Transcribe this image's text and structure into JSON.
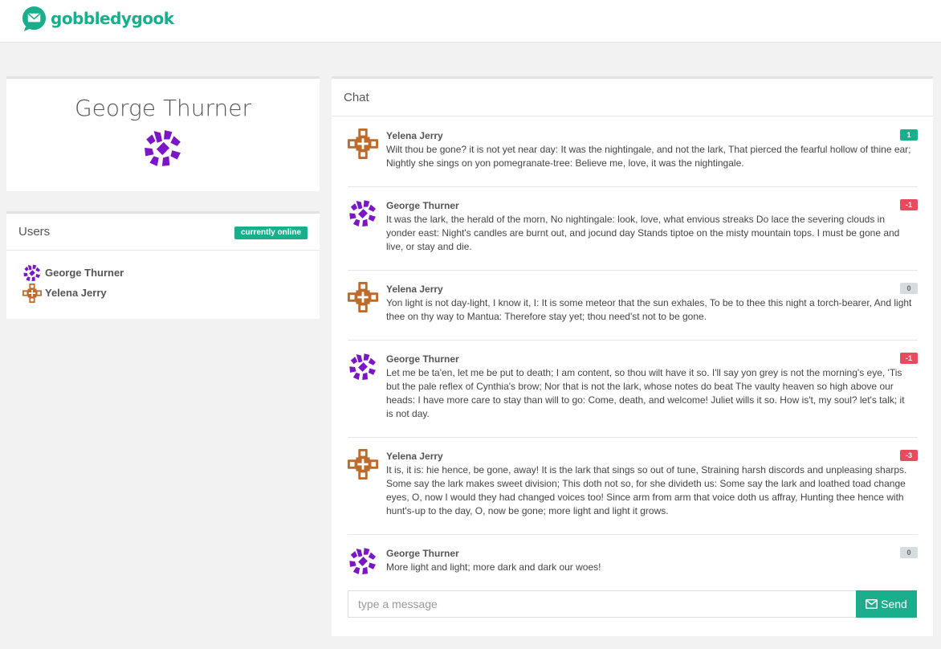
{
  "brand": {
    "name": "gobbledygook",
    "logo_icon": "envelope-bubble-icon",
    "accent": "#1aae8c"
  },
  "profile": {
    "name": "George Thurner",
    "avatar_icon": "purple-pinwheel-avatar"
  },
  "users": {
    "title": "Users",
    "badge": "currently online",
    "items": [
      {
        "name": "George Thurner",
        "avatar_icon": "purple-pinwheel-avatar"
      },
      {
        "name": "Yelena Jerry",
        "avatar_icon": "orange-cross-avatar"
      }
    ]
  },
  "chat": {
    "title": "Chat",
    "messages": [
      {
        "author": "Yelena Jerry",
        "avatar_icon": "orange-cross-avatar",
        "score": "1",
        "text": "Wilt thou be gone? it is not yet near day: It was the nightingale, and not the lark, That pierced the fearful hollow of thine ear; Nightly she sings on yon pomegranate-tree: Believe me, love, it was the nightingale."
      },
      {
        "author": "George Thurner",
        "avatar_icon": "purple-pinwheel-avatar",
        "score": "-1",
        "text": "It was the lark, the herald of the morn, No nightingale: look, love, what envious streaks Do lace the severing clouds in yonder east: Night's candles are burnt out, and jocund day Stands tiptoe on the misty mountain tops. I must be gone and live, or stay and die."
      },
      {
        "author": "Yelena Jerry",
        "avatar_icon": "orange-cross-avatar",
        "score": "0",
        "text": "Yon light is not day-light, I know it, I: It is some meteor that the sun exhales, To be to thee this night a torch-bearer, And light thee on thy way to Mantua: Therefore stay yet; thou need'st not to be gone."
      },
      {
        "author": "George Thurner",
        "avatar_icon": "purple-pinwheel-avatar",
        "score": "-1",
        "text": "Let me be ta'en, let me be put to death; I am content, so thou wilt have it so. I'll say yon grey is not the morning's eye, 'Tis but the pale reflex of Cynthia's brow; Nor that is not the lark, whose notes do beat The vaulty heaven so high above our heads: I have more care to stay than will to go: Come, death, and welcome! Juliet wills it so. How is't, my soul? let's talk; it is not day."
      },
      {
        "author": "Yelena Jerry",
        "avatar_icon": "orange-cross-avatar",
        "score": "-3",
        "text": "It is, it is: hie hence, be gone, away! It is the lark that sings so out of tune, Straining harsh discords and unpleasing sharps. Some say the lark makes sweet division; This doth not so, for she divideth us: Some say the lark and loathed toad change eyes, O, now I would they had changed voices too! Since arm from arm that voice doth us affray, Hunting thee hence with hunt's-up to the day, O, now be gone; more light and light it grows."
      },
      {
        "author": "George Thurner",
        "avatar_icon": "purple-pinwheel-avatar",
        "score": "0",
        "text": "More light and light; more dark and dark our woes!"
      }
    ],
    "input_placeholder": "type a message",
    "send_label": "Send",
    "send_icon": "envelope-icon"
  },
  "colors": {
    "positive": "#1aae8c",
    "negative": "#e74c5e",
    "neutral": "#d6dbdf",
    "pinwheel": "#7b16c8",
    "cross": "#bd6a2a"
  }
}
